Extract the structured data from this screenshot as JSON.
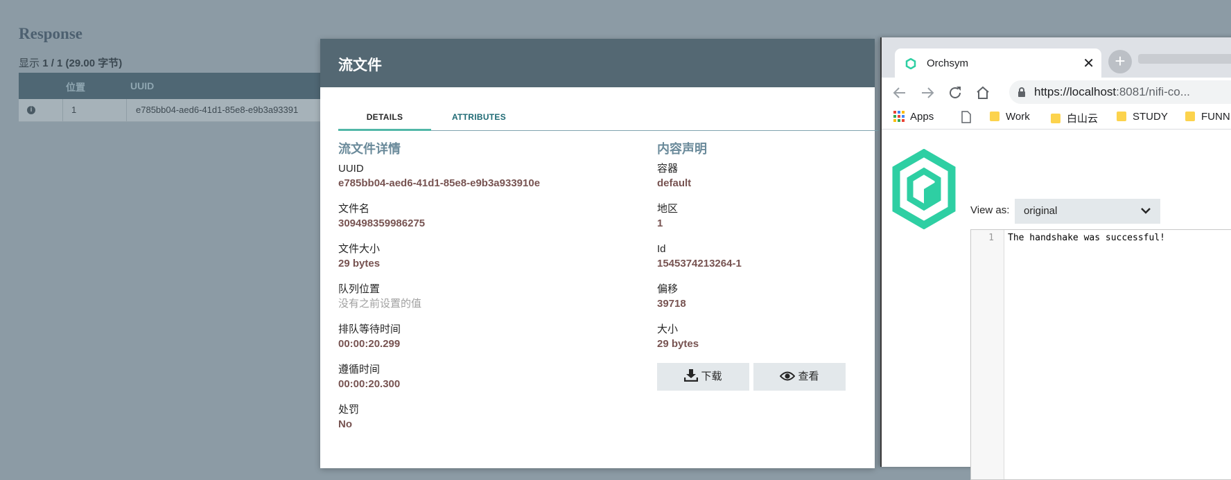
{
  "background": {
    "title": "Response",
    "count_label": "显示",
    "count_value": "1 / 1 (29.00 字节)",
    "columns": [
      "位置",
      "UUID"
    ],
    "row": {
      "position": "1",
      "uuid": "e785bb04-aed6-41d1-85e8-e9b3a93391"
    }
  },
  "modal": {
    "title": "流文件",
    "tabs": [
      {
        "label": "DETAILS",
        "active": true
      },
      {
        "label": "ATTRIBUTES",
        "active": false
      }
    ],
    "left": {
      "title": "流文件详情",
      "fields": [
        {
          "label": "UUID",
          "value": "e785bb04-aed6-41d1-85e8-e9b3a933910e"
        },
        {
          "label": "文件名",
          "value": "309498359986275"
        },
        {
          "label": "文件大小",
          "value": "29 bytes"
        },
        {
          "label": "队列位置",
          "value": "没有之前设置的值"
        },
        {
          "label": "排队等待时间",
          "value": "00:00:20.299"
        },
        {
          "label": "遵循时间",
          "value": "00:00:20.300"
        },
        {
          "label": "处罚",
          "value": "No"
        }
      ]
    },
    "right": {
      "title": "内容声明",
      "fields": [
        {
          "label": "容器",
          "value": "default"
        },
        {
          "label": "地区",
          "value": "1"
        },
        {
          "label": "Id",
          "value": "1545374213264-1"
        },
        {
          "label": "偏移",
          "value": "39718"
        },
        {
          "label": "大小",
          "value": "29 bytes"
        }
      ],
      "download_label": "下载",
      "view_label": "查看"
    }
  },
  "browser": {
    "tab_title": "Orchsym",
    "url_host": "https://localhost",
    "url_rest": ":8081/nifi-co...",
    "bookmarks": [
      "Apps",
      "Work",
      "白山云",
      "STUDY",
      "FUNN"
    ],
    "view_as_label": "View as:",
    "view_as_value": "original",
    "editor": {
      "line_number": "1",
      "line_text": "The handshake was successful!"
    }
  },
  "colors": {
    "accent": "#51b7a8",
    "header": "#546873",
    "value_text": "#775351",
    "logo": "#2ecfa3"
  }
}
